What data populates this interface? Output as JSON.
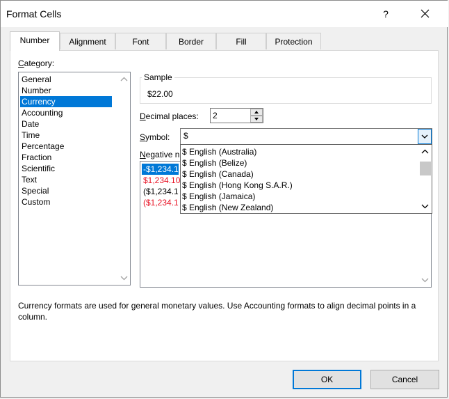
{
  "window": {
    "title": "Format Cells",
    "help_label": "?"
  },
  "tabs": [
    {
      "label": "Number",
      "active": true
    },
    {
      "label": "Alignment"
    },
    {
      "label": "Font"
    },
    {
      "label": "Border"
    },
    {
      "label": "Fill"
    },
    {
      "label": "Protection"
    }
  ],
  "category": {
    "label": "Category:",
    "items": [
      "General",
      "Number",
      "Currency",
      "Accounting",
      "Date",
      "Time",
      "Percentage",
      "Fraction",
      "Scientific",
      "Text",
      "Special",
      "Custom"
    ],
    "selected": "Currency"
  },
  "sample": {
    "label": "Sample",
    "value": "$22.00"
  },
  "decimal_places": {
    "label": "Decimal places:",
    "value": "2"
  },
  "symbol": {
    "label": "Symbol:",
    "value": "$",
    "options": [
      "$ English (Australia)",
      "$ English (Belize)",
      "$ English (Canada)",
      "$ English (Hong Kong S.A.R.)",
      "$ English (Jamaica)",
      "$ English (New Zealand)"
    ]
  },
  "negative_numbers": {
    "label": "Negative n",
    "items": [
      {
        "text": "-$1,234.1",
        "selected": true,
        "red": false
      },
      {
        "text": "$1,234.10",
        "red": true
      },
      {
        "text": "($1,234.1",
        "red": false
      },
      {
        "text": "($1,234.1",
        "red": true
      }
    ]
  },
  "description": "Currency formats are used for general monetary values.  Use Accounting formats to align decimal points in a column.",
  "buttons": {
    "ok": "OK",
    "cancel": "Cancel"
  },
  "colors": {
    "selection": "#0078d7",
    "negative_red": "#e81123"
  }
}
